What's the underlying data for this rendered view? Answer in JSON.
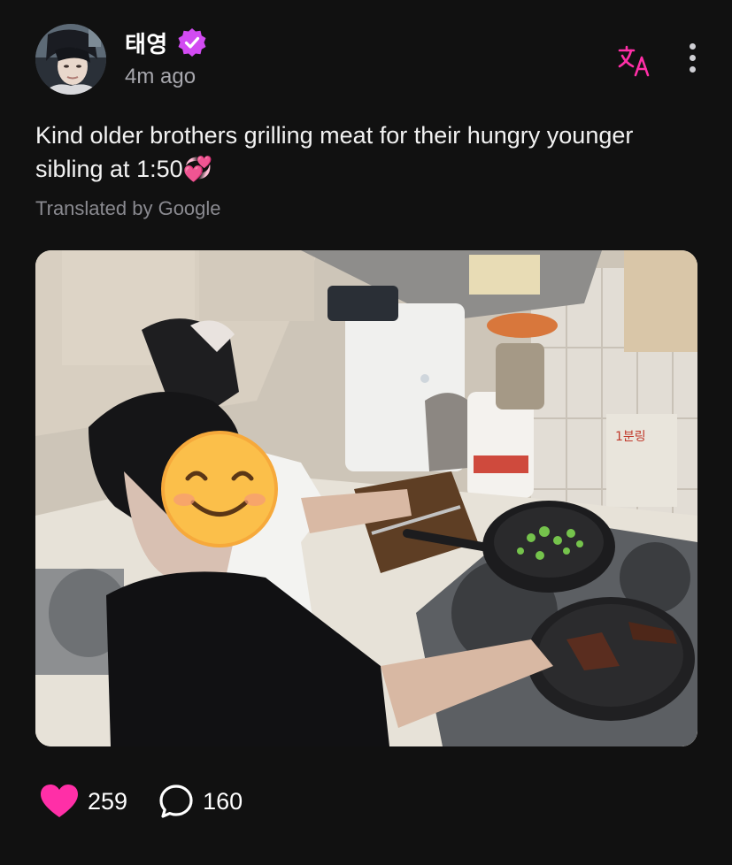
{
  "post": {
    "author": {
      "name": "태영",
      "verified": true,
      "avatar_alt": "profile photo"
    },
    "timestamp": "4m ago",
    "text_line1": "Kind older brothers grilling meat for their hungry younger",
    "text_line2": "sibling at 1:50",
    "emoji": "💞",
    "translation_note": "Translated by Google",
    "stats": {
      "likes": "259",
      "comments": "160"
    }
  },
  "icons": {
    "verified": "verified-badge-icon",
    "translate": "translate-icon",
    "more": "more-vertical-icon",
    "like": "heart-icon",
    "comment": "comment-bubble-icon"
  },
  "colors": {
    "background": "#111111",
    "accent": "#ff2fa7",
    "verified": "#d24bf2",
    "muted_text": "#a7a7ad"
  }
}
